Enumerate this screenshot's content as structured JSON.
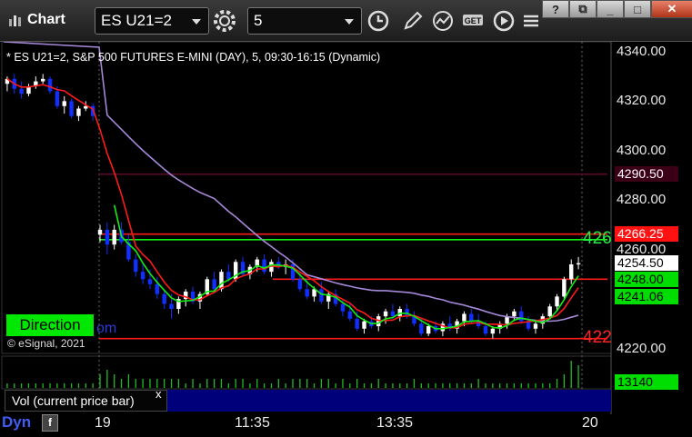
{
  "header": {
    "app_title": "Chart",
    "symbol": "ES U21=2",
    "interval": "5"
  },
  "legend": "* ES U21=2, S&P 500 FUTURES E-MINI (DAY), 5, 09:30-16:15 (Dynamic)",
  "copyright": "© eSignal, 2021",
  "direction_label": "Direction",
  "direction_tail": "om",
  "volume_panel": {
    "label": "Vol (current price bar)",
    "close": "x",
    "value": "13140"
  },
  "footer": {
    "dyn": "Dyn",
    "f_icon": "f"
  },
  "x_axis": [
    "19",
    "11:35",
    "13:35",
    "20"
  ],
  "y_axis": [
    "4340.00",
    "4320.00",
    "4300.00",
    "4280.00",
    "4260.00",
    "4240.00",
    "4220.00"
  ],
  "price_boxes": [
    {
      "label": "4290.50",
      "bg": "#3b0015",
      "fg": "#ffffff"
    },
    {
      "label": "4266.25",
      "bg": "#ff1111",
      "fg": "#ffffff"
    },
    {
      "label": "4254.50",
      "bg": "#ffffff",
      "fg": "#000000"
    },
    {
      "label": "4248.00",
      "bg": "#00dd00",
      "fg": "#000000"
    },
    {
      "label": "4241.06",
      "bg": "#00dd00",
      "fg": "#000000"
    }
  ],
  "level_labels": [
    {
      "label": "426",
      "color": "#22ee44"
    },
    {
      "label": "422",
      "color": "#ff2222"
    }
  ],
  "colors": {
    "up_candle": "#ffffff",
    "down_candle": "#1030ff",
    "ma_red": "#ff1a1a",
    "ma_green": "#11ee11",
    "ma_purple": "#a688d8",
    "volume_bars": "#22bb22"
  },
  "chart_data": {
    "type": "candlestick",
    "title": "",
    "ylim": [
      4218,
      4344
    ],
    "levels": [
      {
        "value": 4290.5,
        "color": "#5a0a2a"
      },
      {
        "value": 4266.25,
        "color": "#ff1a1a"
      },
      {
        "value": 4264,
        "color": "#11ee11"
      },
      {
        "value": 4248,
        "color": "#ff1a1a"
      },
      {
        "value": 4224,
        "color": "#ff1a1a"
      }
    ],
    "candles": [
      [
        4327,
        4330,
        4324,
        4329
      ],
      [
        4329,
        4331,
        4323,
        4325
      ],
      [
        4325,
        4328,
        4321,
        4323
      ],
      [
        4323,
        4327,
        4322,
        4326
      ],
      [
        4326,
        4330,
        4325,
        4328
      ],
      [
        4328,
        4331,
        4327,
        4329
      ],
      [
        4329,
        4330,
        4323,
        4324
      ],
      [
        4324,
        4326,
        4317,
        4318
      ],
      [
        4318,
        4322,
        4315,
        4320
      ],
      [
        4320,
        4321,
        4313,
        4314
      ],
      [
        4314,
        4318,
        4312,
        4317
      ],
      [
        4317,
        4320,
        4316,
        4318
      ],
      [
        4318,
        4319,
        4312,
        4314
      ],
      [
        4266,
        4270,
        4263,
        4268
      ],
      [
        4268,
        4271,
        4258,
        4262
      ],
      [
        4262,
        4270,
        4260,
        4268
      ],
      [
        4268,
        4271,
        4262,
        4263
      ],
      [
        4263,
        4266,
        4255,
        4256
      ],
      [
        4256,
        4258,
        4249,
        4251
      ],
      [
        4251,
        4254,
        4246,
        4248
      ],
      [
        4248,
        4252,
        4244,
        4246
      ],
      [
        4246,
        4249,
        4240,
        4242
      ],
      [
        4242,
        4244,
        4236,
        4238
      ],
      [
        4238,
        4242,
        4232,
        4236
      ],
      [
        4236,
        4241,
        4234,
        4240
      ],
      [
        4240,
        4244,
        4237,
        4243
      ],
      [
        4243,
        4245,
        4238,
        4239
      ],
      [
        4239,
        4243,
        4236,
        4242
      ],
      [
        4242,
        4249,
        4241,
        4248
      ],
      [
        4248,
        4251,
        4243,
        4244
      ],
      [
        4244,
        4252,
        4243,
        4251
      ],
      [
        4251,
        4254,
        4247,
        4248
      ],
      [
        4248,
        4256,
        4247,
        4255
      ],
      [
        4255,
        4257,
        4249,
        4250
      ],
      [
        4250,
        4254,
        4248,
        4253
      ],
      [
        4253,
        4257,
        4251,
        4256
      ],
      [
        4256,
        4258,
        4250,
        4251
      ],
      [
        4251,
        4256,
        4249,
        4255
      ],
      [
        4255,
        4257,
        4252,
        4253
      ],
      [
        4253,
        4256,
        4250,
        4254
      ],
      [
        4254,
        4256,
        4247,
        4248
      ],
      [
        4248,
        4251,
        4243,
        4244
      ],
      [
        4244,
        4248,
        4240,
        4241
      ],
      [
        4241,
        4245,
        4239,
        4244
      ],
      [
        4244,
        4247,
        4238,
        4239
      ],
      [
        4239,
        4243,
        4236,
        4242
      ],
      [
        4242,
        4244,
        4237,
        4238
      ],
      [
        4238,
        4240,
        4233,
        4235
      ],
      [
        4235,
        4238,
        4231,
        4232
      ],
      [
        4232,
        4235,
        4227,
        4228
      ],
      [
        4228,
        4232,
        4226,
        4231
      ],
      [
        4231,
        4233,
        4228,
        4229
      ],
      [
        4229,
        4234,
        4227,
        4233
      ],
      [
        4233,
        4236,
        4230,
        4235
      ],
      [
        4235,
        4238,
        4232,
        4233
      ],
      [
        4233,
        4237,
        4231,
        4236
      ],
      [
        4236,
        4238,
        4232,
        4233
      ],
      [
        4233,
        4235,
        4229,
        4230
      ],
      [
        4230,
        4232,
        4225,
        4226
      ],
      [
        4226,
        4230,
        4225,
        4229
      ],
      [
        4229,
        4231,
        4226,
        4227
      ],
      [
        4227,
        4231,
        4225,
        4230
      ],
      [
        4230,
        4233,
        4227,
        4228
      ],
      [
        4228,
        4232,
        4226,
        4231
      ],
      [
        4231,
        4235,
        4229,
        4234
      ],
      [
        4234,
        4236,
        4230,
        4231
      ],
      [
        4231,
        4234,
        4228,
        4229
      ],
      [
        4229,
        4231,
        4225,
        4226
      ],
      [
        4226,
        4229,
        4224,
        4228
      ],
      [
        4228,
        4231,
        4226,
        4230
      ],
      [
        4230,
        4234,
        4228,
        4233
      ],
      [
        4233,
        4236,
        4231,
        4235
      ],
      [
        4235,
        4237,
        4230,
        4231
      ],
      [
        4231,
        4233,
        4227,
        4228
      ],
      [
        4228,
        4231,
        4226,
        4230
      ],
      [
        4230,
        4234,
        4228,
        4233
      ],
      [
        4233,
        4238,
        4232,
        4237
      ],
      [
        4237,
        4242,
        4235,
        4241
      ],
      [
        4241,
        4249,
        4240,
        4248
      ],
      [
        4248,
        4256,
        4246,
        4254
      ],
      [
        4254,
        4257,
        4252,
        4254.5
      ]
    ],
    "volume": [
      1,
      1,
      1,
      1,
      1,
      1,
      1,
      1,
      1,
      1,
      1,
      1,
      1,
      3,
      4,
      3,
      2,
      3,
      2,
      2,
      2,
      2,
      2,
      2,
      2,
      1,
      2,
      1,
      2,
      2,
      2,
      1,
      2,
      2,
      1,
      2,
      1,
      1,
      2,
      1,
      2,
      2,
      2,
      1,
      2,
      2,
      1,
      2,
      1,
      2,
      1,
      1,
      2,
      1,
      1,
      1,
      1,
      2,
      1,
      1,
      1,
      1,
      1,
      1,
      1,
      1,
      2,
      1,
      1,
      1,
      1,
      1,
      1,
      1,
      1,
      1,
      1,
      2,
      3,
      6,
      5
    ]
  }
}
